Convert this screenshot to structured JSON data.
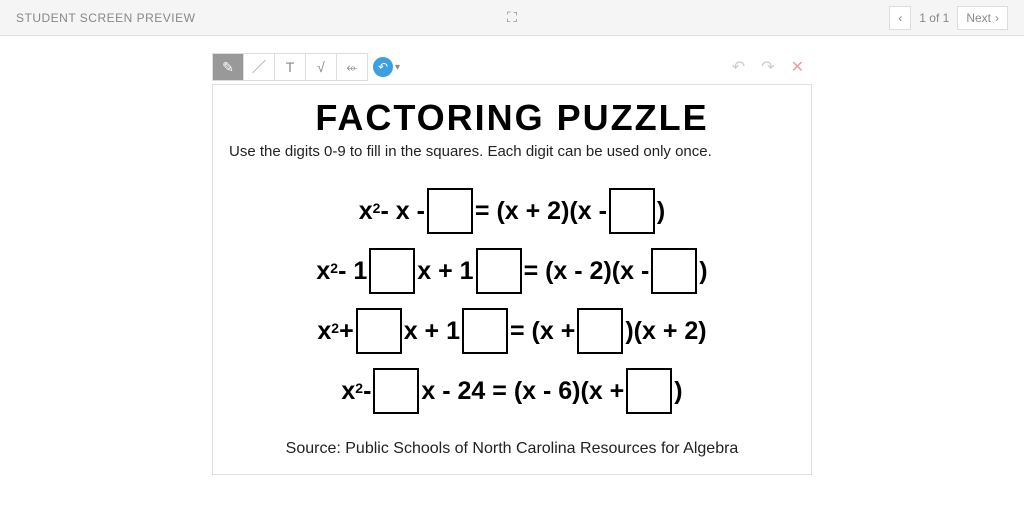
{
  "header": {
    "title": "STUDENT SCREEN PREVIEW",
    "pageIndicator": "1 of 1",
    "nextLabel": "Next"
  },
  "worksheet": {
    "title": "FACTORING PUZZLE",
    "subtitle": "Use the digits 0-9 to fill in the squares. Each digit can be used only once.",
    "eq1": {
      "p1": "x",
      "p2": " - x - ",
      "p3": "= (x + 2)(x -",
      "p4": ")"
    },
    "eq2": {
      "p1": "x",
      "p2": " - 1",
      "p3": "x + 1",
      "p4": " = (x - 2)(x -",
      "p5": ")"
    },
    "eq3": {
      "p1": "x",
      "p2": " +",
      "p3": "x + 1",
      "p4": " = (x +",
      "p5": ")(x + 2)"
    },
    "eq4": {
      "p1": "x",
      "p2": " - ",
      "p3": "x - 24 = (x - 6)(x +",
      "p4": ")"
    },
    "source": "Source: Public Schools of North Carolina Resources for Algebra"
  },
  "icons": {
    "expand": "⛶",
    "prev": "‹",
    "next": "›",
    "pencil": "✎",
    "line": "／",
    "text": "T",
    "math": "√",
    "eraser": "⬰",
    "reset": "↶",
    "caret": "▾",
    "undo": "↶",
    "redo": "↷",
    "close": "✕",
    "sup2": "2"
  }
}
